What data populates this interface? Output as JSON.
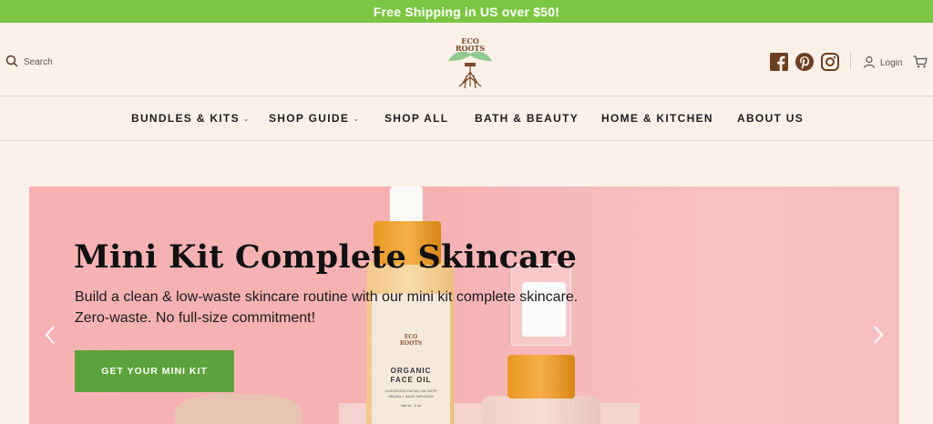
{
  "promo": {
    "text": "Free Shipping in US over $50!"
  },
  "header": {
    "search_label": "Search",
    "logo_text_line1": "ECO",
    "logo_text_line2": "ROOTS",
    "socials": [
      "facebook-icon",
      "pinterest-icon",
      "instagram-icon"
    ],
    "login_label": "Login"
  },
  "nav": {
    "items": [
      {
        "label": "BUNDLES & KITS",
        "has_dropdown": true
      },
      {
        "label": "SHOP GUIDE",
        "has_dropdown": true
      },
      {
        "label": "SHOP ALL",
        "has_dropdown": false
      },
      {
        "label": "BATH & BEAUTY",
        "has_dropdown": false
      },
      {
        "label": "HOME & KITCHEN",
        "has_dropdown": false
      },
      {
        "label": "ABOUT US",
        "has_dropdown": false
      }
    ],
    "caret": "⌄"
  },
  "hero": {
    "title": "Mini Kit Complete Skincare",
    "subtitle": "Build a clean & low-waste skincare routine with our mini kit complete skincare. Zero-waste. No full-size commitment!",
    "cta_label": "GET YOUR MINI KIT",
    "product_label": {
      "logo_line1": "ECO",
      "logo_line2": "ROOTS",
      "name_line1": "ORGANIC",
      "name_line2": "FACE OIL",
      "small_text": "LUXURIOUS FACIAL OIL WITH ARGAN + SAGE INFUSION",
      "net_text": "Net wt. .5 oz"
    }
  },
  "colors": {
    "promo_bg": "#7bc743",
    "page_bg": "#fcf1e9",
    "cta_bg": "#5ba33a",
    "hero_bg": "#f7b3b3",
    "social_icon": "#6b3f22"
  }
}
